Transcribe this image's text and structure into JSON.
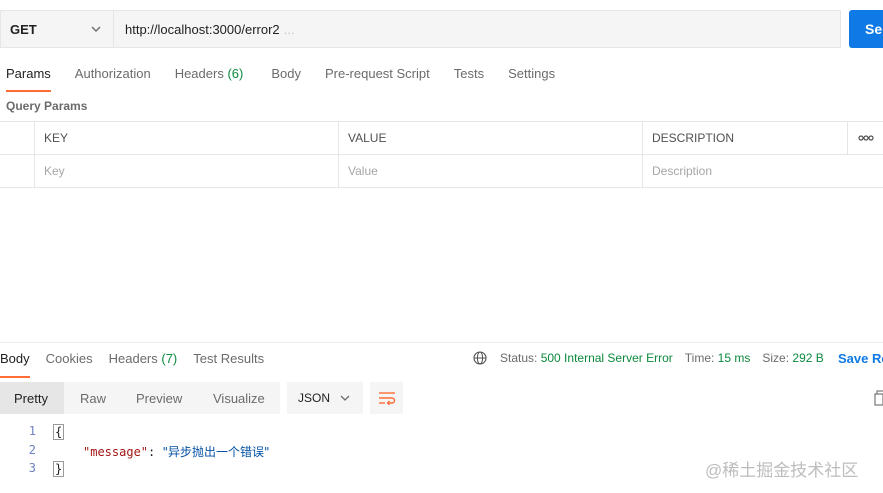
{
  "request": {
    "method": "GET",
    "url": "http://localhost:3000/error2",
    "url_overflow": "...",
    "send_label": "Se"
  },
  "request_tabs": [
    {
      "label": "Params",
      "active": true
    },
    {
      "label": "Authorization"
    },
    {
      "label": "Headers",
      "count": "(6)"
    },
    {
      "label": "Body"
    },
    {
      "label": "Pre-request Script"
    },
    {
      "label": "Tests"
    },
    {
      "label": "Settings"
    }
  ],
  "query_params": {
    "section_label": "Query Params",
    "headers": [
      "KEY",
      "VALUE",
      "DESCRIPTION"
    ],
    "more_label": "ooo",
    "placeholders": [
      "Key",
      "Value",
      "Description"
    ]
  },
  "response": {
    "tabs": [
      {
        "label": "Body",
        "active": true
      },
      {
        "label": "Cookies"
      },
      {
        "label": "Headers",
        "count": "(7)"
      },
      {
        "label": "Test Results"
      }
    ],
    "status_label": "Status:",
    "status_value": "500 Internal Server Error",
    "time_label": "Time:",
    "time_value": "15 ms",
    "size_label": "Size:",
    "size_value": "292 B",
    "save_label": "Save Re",
    "view_modes": [
      "Pretty",
      "Raw",
      "Preview",
      "Visualize"
    ],
    "format": "JSON",
    "code_lines": [
      {
        "num": "1",
        "text": "{"
      },
      {
        "num": "2",
        "key": "\"message\"",
        "colon": ": ",
        "value": "\"异步抛出一个错误\""
      },
      {
        "num": "3",
        "text": "}"
      }
    ]
  },
  "watermark": "@稀土掘金技术社区",
  "colors": {
    "accent_tab": "#ff6c37",
    "send_button": "#0f7ae5",
    "status_ok_green": "#0b8a3d",
    "json_key": "#a31515",
    "json_value": "#0451a5"
  }
}
